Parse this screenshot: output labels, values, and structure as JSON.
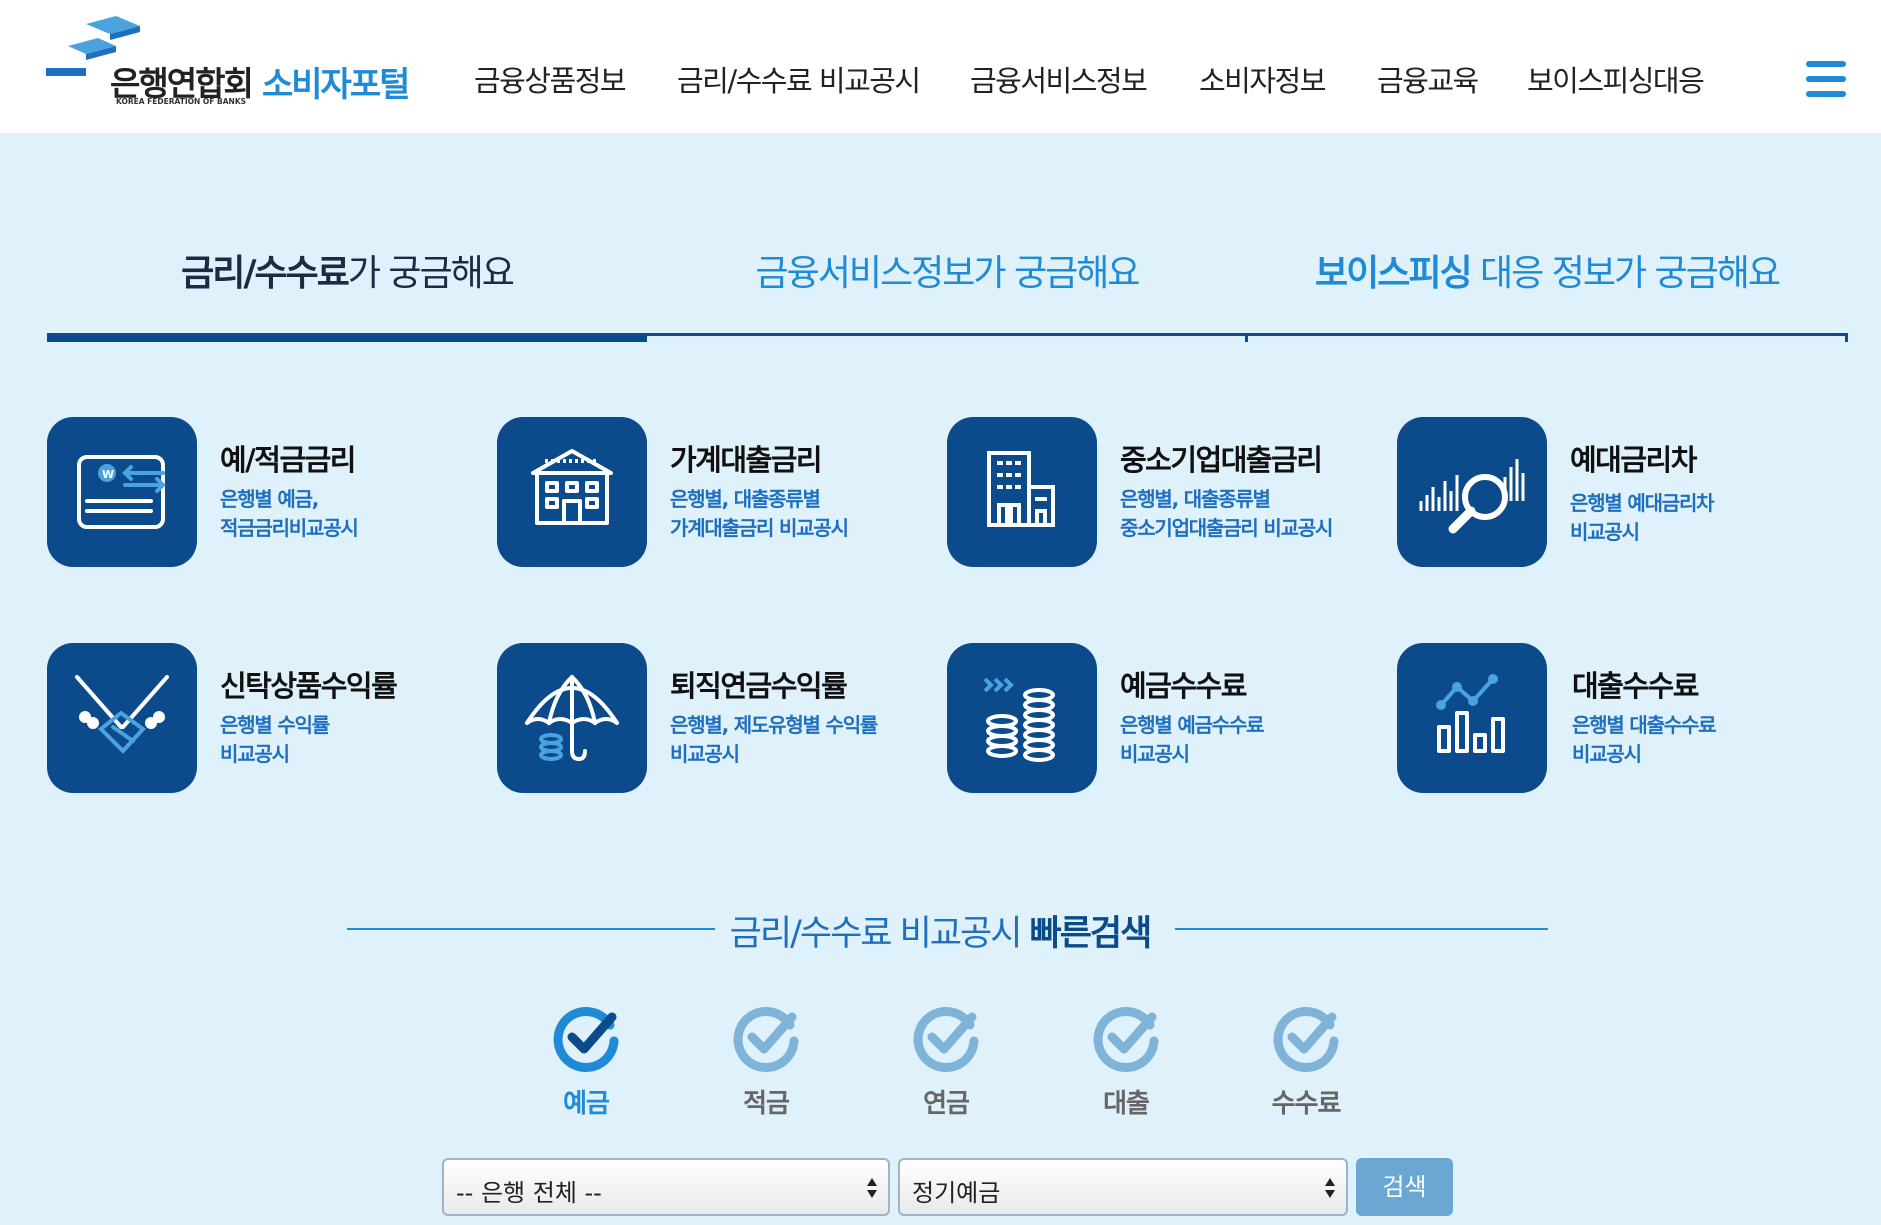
{
  "header": {
    "logo_name": "은행연합회",
    "logo_sub": "KOREA FEDERATION OF BANKS",
    "portal": "소비자포털",
    "nav": [
      "금융상품정보",
      "금리/수수료 비교공시",
      "금융서비스정보",
      "소비자정보",
      "금융교육",
      "보이스피싱대응"
    ],
    "menu_icon": "hamburger-icon"
  },
  "tabs": [
    {
      "strong": "금리/수수료",
      "rest": "가 궁금해요",
      "active": true
    },
    {
      "strong": "",
      "rest": "금융서비스정보가 궁금해요",
      "active": false
    },
    {
      "strong": "보이스피싱",
      "rest": " 대응 정보가 궁금해요",
      "active": false
    }
  ],
  "services": [
    {
      "title": "예/적금금리",
      "desc1": "은행별 예금,",
      "desc2": "적금금리비교공시",
      "icon": "deposit-card-icon"
    },
    {
      "title": "가계대출금리",
      "desc1": "은행별, 대출종류별",
      "desc2": "가계대출금리 비교공시",
      "icon": "house-icon"
    },
    {
      "title": "중소기업대출금리",
      "desc1": "은행별, 대출종류별",
      "desc2": "중소기업대출금리 비교공시",
      "icon": "building-icon"
    },
    {
      "title": "예대금리차",
      "desc1": "은행별 예대금리차",
      "desc2": "비교공시",
      "icon": "magnifier-chart-icon"
    },
    {
      "title": "신탁상품수익률",
      "desc1": "은행별 수익률",
      "desc2": "비교공시",
      "icon": "handshake-icon"
    },
    {
      "title": "퇴직연금수익률",
      "desc1": "은행별, 제도유형별 수익률",
      "desc2": "비교공시",
      "icon": "umbrella-icon"
    },
    {
      "title": "예금수수료",
      "desc1": "은행별 예금수수료",
      "desc2": "비교공시",
      "icon": "coins-icon"
    },
    {
      "title": "대출수수료",
      "desc1": "은행별 대출수수료",
      "desc2": "비교공시",
      "icon": "bar-chart-icon"
    }
  ],
  "quick_search": {
    "title_normal": "금리/수수료 비교공시 ",
    "title_bold": "빠른검색",
    "categories": [
      {
        "label": "예금",
        "active": true
      },
      {
        "label": "적금",
        "active": false
      },
      {
        "label": "연금",
        "active": false
      },
      {
        "label": "대출",
        "active": false
      },
      {
        "label": "수수료",
        "active": false
      }
    ],
    "bank_select": "-- 은행 전체 --",
    "product_select": "정기예금",
    "search_label": "검색"
  },
  "colors": {
    "primary": "#0b4a8b",
    "accent": "#1f8ad6",
    "background": "#dff1fb",
    "check_inactive": "#7fb3d8"
  }
}
